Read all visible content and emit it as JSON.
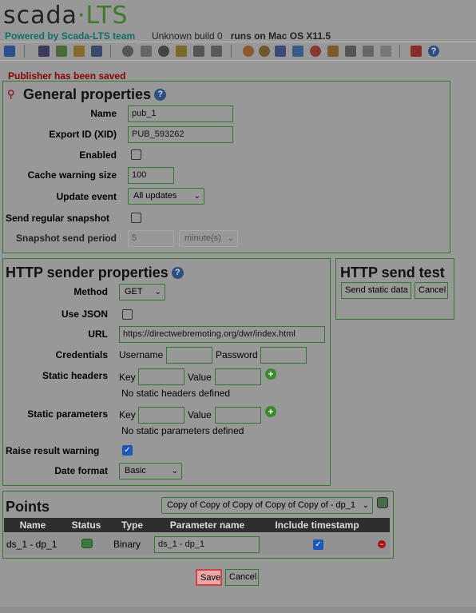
{
  "brand": {
    "logo_main": "scada",
    "logo_dot": "·",
    "logo_suffix": "LTS"
  },
  "header": {
    "powered_by": "Powered by Scada-LTS team",
    "build_text": "Unknown build 0",
    "runs_on": "runs on Mac OS X11.5"
  },
  "toolbar": {
    "icons": [
      "watchlist-icon",
      "graphics-icon",
      "screens-icon",
      "comments-icon",
      "events-icon",
      "datasources-icon",
      "database-icon",
      "scheduled-events-icon",
      "compound-events-icon",
      "point-links-icon",
      "scripts-icon",
      "users-icon",
      "user-profiles-icon",
      "mailing-lists-icon",
      "publishers-icon",
      "system-settings-icon",
      "maintenance-icon",
      "emport-icon",
      "sql-icon",
      "reports-icon",
      "logout-icon",
      "help-icon"
    ]
  },
  "message": "Publisher has been saved",
  "general": {
    "title": "General properties",
    "name_label": "Name",
    "name_value": "pub_1",
    "xid_label": "Export ID (XID)",
    "xid_value": "PUB_593262",
    "enabled_label": "Enabled",
    "enabled_checked": false,
    "cache_label": "Cache warning size",
    "cache_value": "100",
    "update_label": "Update event",
    "update_value": "All updates",
    "snapshot_label": "Send regular snapshot",
    "snapshot_checked": false,
    "period_label": "Snapshot send period",
    "period_value": "5",
    "period_unit": "minute(s)"
  },
  "http": {
    "title": "HTTP sender properties",
    "method_label": "Method",
    "method_value": "GET",
    "json_label": "Use JSON",
    "json_checked": false,
    "url_label": "URL",
    "url_value": "https://directwebremoting.org/dwr/index.html",
    "cred_label": "Credentials",
    "username_label": "Username",
    "password_label": "Password",
    "headers_label": "Static headers",
    "key_label": "Key",
    "value_label": "Value",
    "no_headers": "No static headers defined",
    "params_label": "Static parameters",
    "no_params": "No static parameters defined",
    "raise_label": "Raise result warning",
    "raise_checked": true,
    "date_label": "Date format",
    "date_value": "Basic"
  },
  "test": {
    "title": "HTTP send test",
    "send_label": "Send static data",
    "cancel_label": "Cancel"
  },
  "points": {
    "title": "Points",
    "select_value": "Copy of Copy of Copy of Copy of Copy of - dp_1",
    "columns": [
      "Name",
      "Status",
      "Type",
      "Parameter name",
      "Include timestamp"
    ],
    "rows": [
      {
        "name": "ds_1 - dp_1",
        "type": "Binary",
        "parameter": "ds_1 - dp_1",
        "include_timestamp": true
      }
    ]
  },
  "footer": {
    "save_label": "Save",
    "cancel_label": "Cancel"
  },
  "colors": {
    "panel_border": "#2f7a2f",
    "message": "#8b0000",
    "brand": "#0e6f6a",
    "check_on": "#1d58b8"
  }
}
